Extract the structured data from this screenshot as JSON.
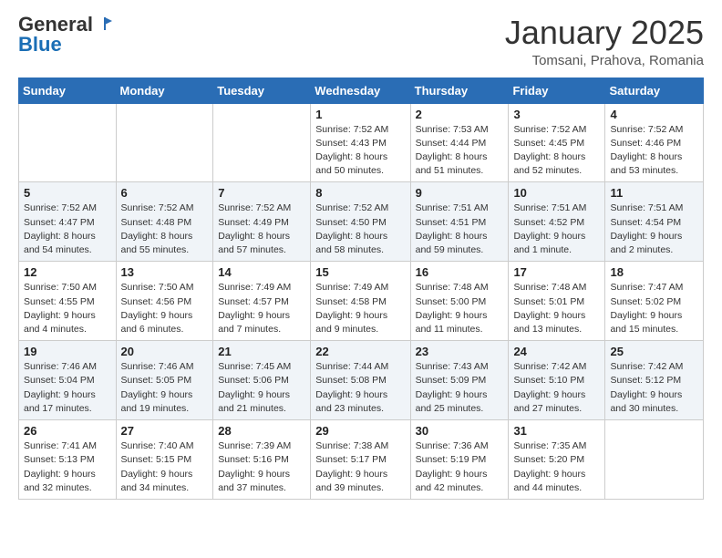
{
  "logo": {
    "general": "General",
    "blue": "Blue"
  },
  "header": {
    "month": "January 2025",
    "location": "Tomsani, Prahova, Romania"
  },
  "weekdays": [
    "Sunday",
    "Monday",
    "Tuesday",
    "Wednesday",
    "Thursday",
    "Friday",
    "Saturday"
  ],
  "weeks": [
    [
      {
        "day": "",
        "sunrise": "",
        "sunset": "",
        "daylight": ""
      },
      {
        "day": "",
        "sunrise": "",
        "sunset": "",
        "daylight": ""
      },
      {
        "day": "",
        "sunrise": "",
        "sunset": "",
        "daylight": ""
      },
      {
        "day": "1",
        "sunrise": "Sunrise: 7:52 AM",
        "sunset": "Sunset: 4:43 PM",
        "daylight": "Daylight: 8 hours and 50 minutes."
      },
      {
        "day": "2",
        "sunrise": "Sunrise: 7:53 AM",
        "sunset": "Sunset: 4:44 PM",
        "daylight": "Daylight: 8 hours and 51 minutes."
      },
      {
        "day": "3",
        "sunrise": "Sunrise: 7:52 AM",
        "sunset": "Sunset: 4:45 PM",
        "daylight": "Daylight: 8 hours and 52 minutes."
      },
      {
        "day": "4",
        "sunrise": "Sunrise: 7:52 AM",
        "sunset": "Sunset: 4:46 PM",
        "daylight": "Daylight: 8 hours and 53 minutes."
      }
    ],
    [
      {
        "day": "5",
        "sunrise": "Sunrise: 7:52 AM",
        "sunset": "Sunset: 4:47 PM",
        "daylight": "Daylight: 8 hours and 54 minutes."
      },
      {
        "day": "6",
        "sunrise": "Sunrise: 7:52 AM",
        "sunset": "Sunset: 4:48 PM",
        "daylight": "Daylight: 8 hours and 55 minutes."
      },
      {
        "day": "7",
        "sunrise": "Sunrise: 7:52 AM",
        "sunset": "Sunset: 4:49 PM",
        "daylight": "Daylight: 8 hours and 57 minutes."
      },
      {
        "day": "8",
        "sunrise": "Sunrise: 7:52 AM",
        "sunset": "Sunset: 4:50 PM",
        "daylight": "Daylight: 8 hours and 58 minutes."
      },
      {
        "day": "9",
        "sunrise": "Sunrise: 7:51 AM",
        "sunset": "Sunset: 4:51 PM",
        "daylight": "Daylight: 8 hours and 59 minutes."
      },
      {
        "day": "10",
        "sunrise": "Sunrise: 7:51 AM",
        "sunset": "Sunset: 4:52 PM",
        "daylight": "Daylight: 9 hours and 1 minute."
      },
      {
        "day": "11",
        "sunrise": "Sunrise: 7:51 AM",
        "sunset": "Sunset: 4:54 PM",
        "daylight": "Daylight: 9 hours and 2 minutes."
      }
    ],
    [
      {
        "day": "12",
        "sunrise": "Sunrise: 7:50 AM",
        "sunset": "Sunset: 4:55 PM",
        "daylight": "Daylight: 9 hours and 4 minutes."
      },
      {
        "day": "13",
        "sunrise": "Sunrise: 7:50 AM",
        "sunset": "Sunset: 4:56 PM",
        "daylight": "Daylight: 9 hours and 6 minutes."
      },
      {
        "day": "14",
        "sunrise": "Sunrise: 7:49 AM",
        "sunset": "Sunset: 4:57 PM",
        "daylight": "Daylight: 9 hours and 7 minutes."
      },
      {
        "day": "15",
        "sunrise": "Sunrise: 7:49 AM",
        "sunset": "Sunset: 4:58 PM",
        "daylight": "Daylight: 9 hours and 9 minutes."
      },
      {
        "day": "16",
        "sunrise": "Sunrise: 7:48 AM",
        "sunset": "Sunset: 5:00 PM",
        "daylight": "Daylight: 9 hours and 11 minutes."
      },
      {
        "day": "17",
        "sunrise": "Sunrise: 7:48 AM",
        "sunset": "Sunset: 5:01 PM",
        "daylight": "Daylight: 9 hours and 13 minutes."
      },
      {
        "day": "18",
        "sunrise": "Sunrise: 7:47 AM",
        "sunset": "Sunset: 5:02 PM",
        "daylight": "Daylight: 9 hours and 15 minutes."
      }
    ],
    [
      {
        "day": "19",
        "sunrise": "Sunrise: 7:46 AM",
        "sunset": "Sunset: 5:04 PM",
        "daylight": "Daylight: 9 hours and 17 minutes."
      },
      {
        "day": "20",
        "sunrise": "Sunrise: 7:46 AM",
        "sunset": "Sunset: 5:05 PM",
        "daylight": "Daylight: 9 hours and 19 minutes."
      },
      {
        "day": "21",
        "sunrise": "Sunrise: 7:45 AM",
        "sunset": "Sunset: 5:06 PM",
        "daylight": "Daylight: 9 hours and 21 minutes."
      },
      {
        "day": "22",
        "sunrise": "Sunrise: 7:44 AM",
        "sunset": "Sunset: 5:08 PM",
        "daylight": "Daylight: 9 hours and 23 minutes."
      },
      {
        "day": "23",
        "sunrise": "Sunrise: 7:43 AM",
        "sunset": "Sunset: 5:09 PM",
        "daylight": "Daylight: 9 hours and 25 minutes."
      },
      {
        "day": "24",
        "sunrise": "Sunrise: 7:42 AM",
        "sunset": "Sunset: 5:10 PM",
        "daylight": "Daylight: 9 hours and 27 minutes."
      },
      {
        "day": "25",
        "sunrise": "Sunrise: 7:42 AM",
        "sunset": "Sunset: 5:12 PM",
        "daylight": "Daylight: 9 hours and 30 minutes."
      }
    ],
    [
      {
        "day": "26",
        "sunrise": "Sunrise: 7:41 AM",
        "sunset": "Sunset: 5:13 PM",
        "daylight": "Daylight: 9 hours and 32 minutes."
      },
      {
        "day": "27",
        "sunrise": "Sunrise: 7:40 AM",
        "sunset": "Sunset: 5:15 PM",
        "daylight": "Daylight: 9 hours and 34 minutes."
      },
      {
        "day": "28",
        "sunrise": "Sunrise: 7:39 AM",
        "sunset": "Sunset: 5:16 PM",
        "daylight": "Daylight: 9 hours and 37 minutes."
      },
      {
        "day": "29",
        "sunrise": "Sunrise: 7:38 AM",
        "sunset": "Sunset: 5:17 PM",
        "daylight": "Daylight: 9 hours and 39 minutes."
      },
      {
        "day": "30",
        "sunrise": "Sunrise: 7:36 AM",
        "sunset": "Sunset: 5:19 PM",
        "daylight": "Daylight: 9 hours and 42 minutes."
      },
      {
        "day": "31",
        "sunrise": "Sunrise: 7:35 AM",
        "sunset": "Sunset: 5:20 PM",
        "daylight": "Daylight: 9 hours and 44 minutes."
      },
      {
        "day": "",
        "sunrise": "",
        "sunset": "",
        "daylight": ""
      }
    ]
  ]
}
